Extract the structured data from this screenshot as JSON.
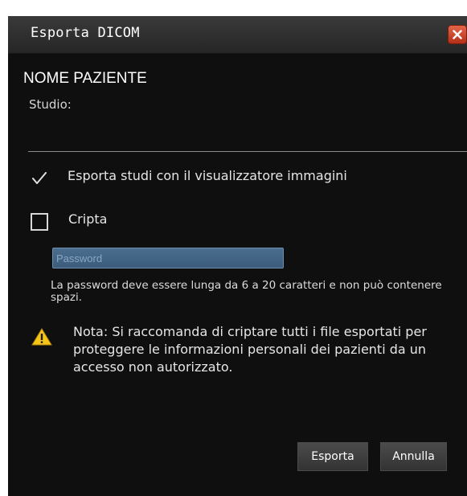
{
  "dialog": {
    "title": "Esporta DICOM",
    "close_icon": "close-icon"
  },
  "patient": {
    "name": "NOME PAZIENTE",
    "study_label": "Studio:"
  },
  "options": {
    "export_with_viewer": {
      "label": "Esporta studi con il visualizzatore immagini",
      "checked": true,
      "icon": "checkmark-icon"
    },
    "encrypt": {
      "label": "Cripta",
      "checked": false
    }
  },
  "password": {
    "placeholder": "Password",
    "value": "",
    "hint": "La password deve essere lunga da 6 a 20 caratteri e non può contenere spazi."
  },
  "note": {
    "icon": "warning-icon",
    "text": "Nota: Si raccomanda di criptare tutti i file esportati per proteggere le informazioni personali dei pazienti da un accesso non autorizzato."
  },
  "buttons": {
    "export_label": "Esporta",
    "cancel_label": "Annulla"
  },
  "colors": {
    "background": "#0f0f0f",
    "titlebar": "#2e2e2e",
    "close_button": "#c9432a",
    "password_field": "#426585",
    "warning": "#f5c518"
  }
}
